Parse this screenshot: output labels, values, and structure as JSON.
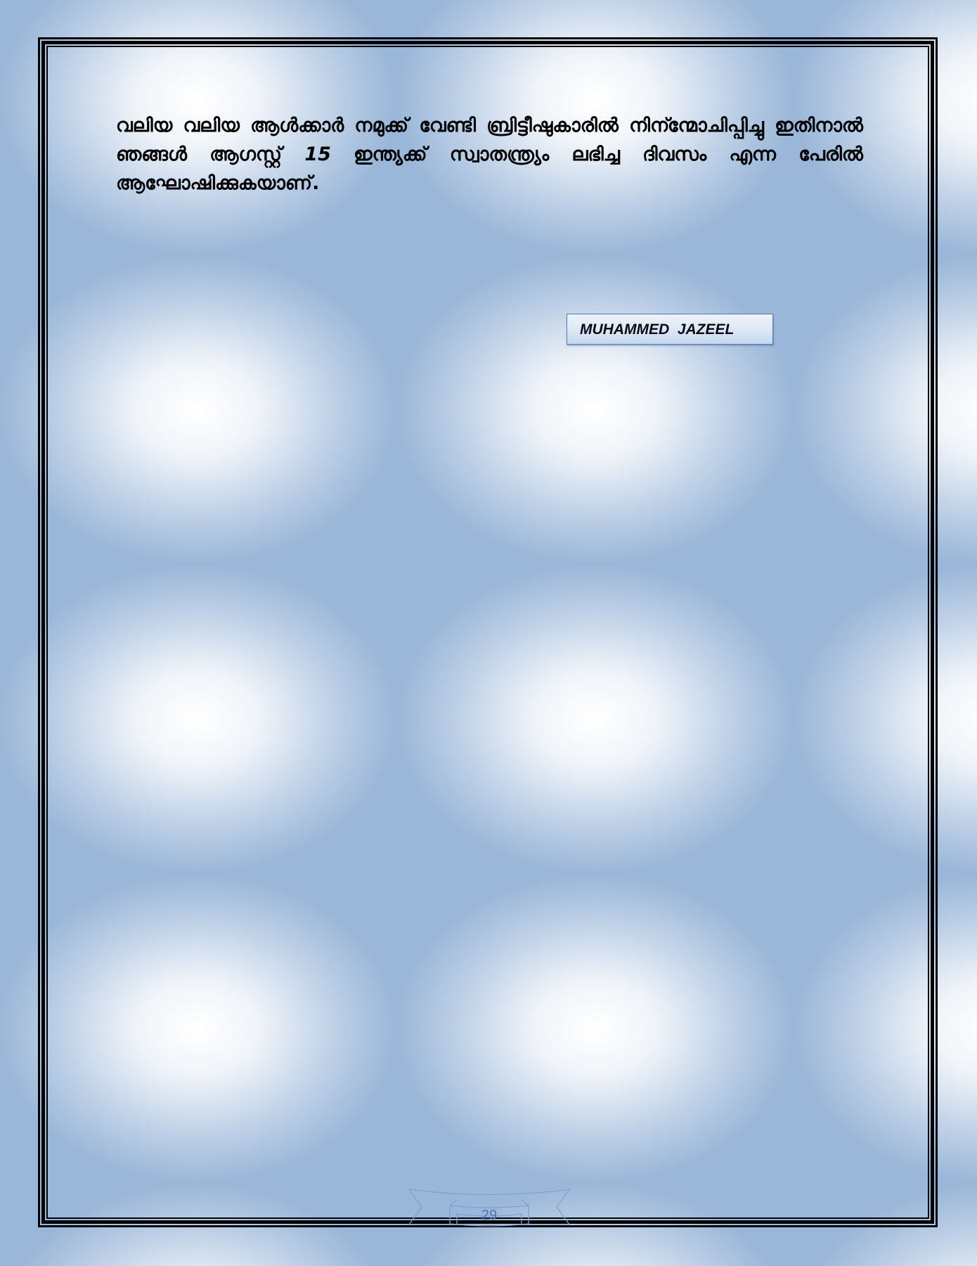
{
  "document": {
    "paragraph_part1": "വലിയ വലിയ ആൾക്കാർ നമുക്ക് വേണ്ടി ബ്രിട്ടീഷുകാരിൽ നിന്ന്മോചിപ്പിച്ചു ഇതിനാൽ ഞങ്ങൾ ആഗസ്റ്റ്",
    "paragraph_number": "15",
    "paragraph_part2": "ഇന്ത്യക്ക് സ്വാതന്ത്ര്യം ലഭിച്ച ദിവസം എന്ന പേരിൽ ആഘോഷിക്കുകയാണ്.",
    "author_name": "MUHAMMED  JAZEEL",
    "page_number": "29"
  },
  "colors": {
    "background": "#9ab6d8",
    "border": "#000000",
    "name_box_border": "#4a7ab8",
    "page_number": "#4f74b0"
  }
}
